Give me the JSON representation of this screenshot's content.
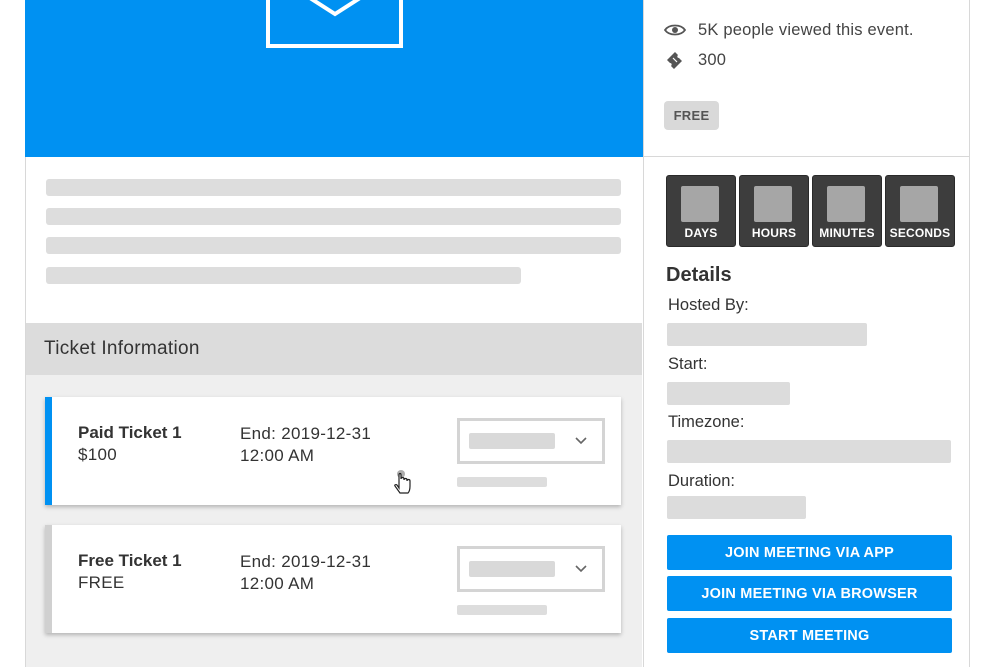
{
  "event_info": {
    "views_text": "5K people viewed this event.",
    "tickets_count": "300",
    "price_badge": "FREE"
  },
  "ticket_section": {
    "title": "Ticket Information",
    "tickets": [
      {
        "name": "Paid Ticket 1",
        "price": "$100",
        "end_line1": "End: 2019-12-31",
        "end_line2": "12:00 AM"
      },
      {
        "name": "Free Ticket 1",
        "price": "FREE",
        "end_line1": "End: 2019-12-31",
        "end_line2": "12:00 AM"
      }
    ]
  },
  "countdown": {
    "labels": [
      "DAYS",
      "HOURS",
      "MINUTES",
      "SECONDS"
    ]
  },
  "details": {
    "title": "Details",
    "hosted_by_label": "Hosted By:",
    "start_label": "Start:",
    "timezone_label": "Timezone:",
    "duration_label": "Duration:"
  },
  "actions": {
    "join_app": "JOIN MEETING VIA APP",
    "join_browser": "JOIN MEETING VIA BROWSER",
    "start_meeting": "START MEETING"
  },
  "colors": {
    "accent": "#0091f2",
    "skeleton": "#dddddd",
    "timer_bg": "#3d3d3d"
  },
  "icons": {
    "hero": "image-placeholder-icon",
    "views": "eye-icon",
    "tickets": "ticket-icon",
    "select": "chevron-down-icon",
    "cursor": "hand-pointer-icon"
  }
}
